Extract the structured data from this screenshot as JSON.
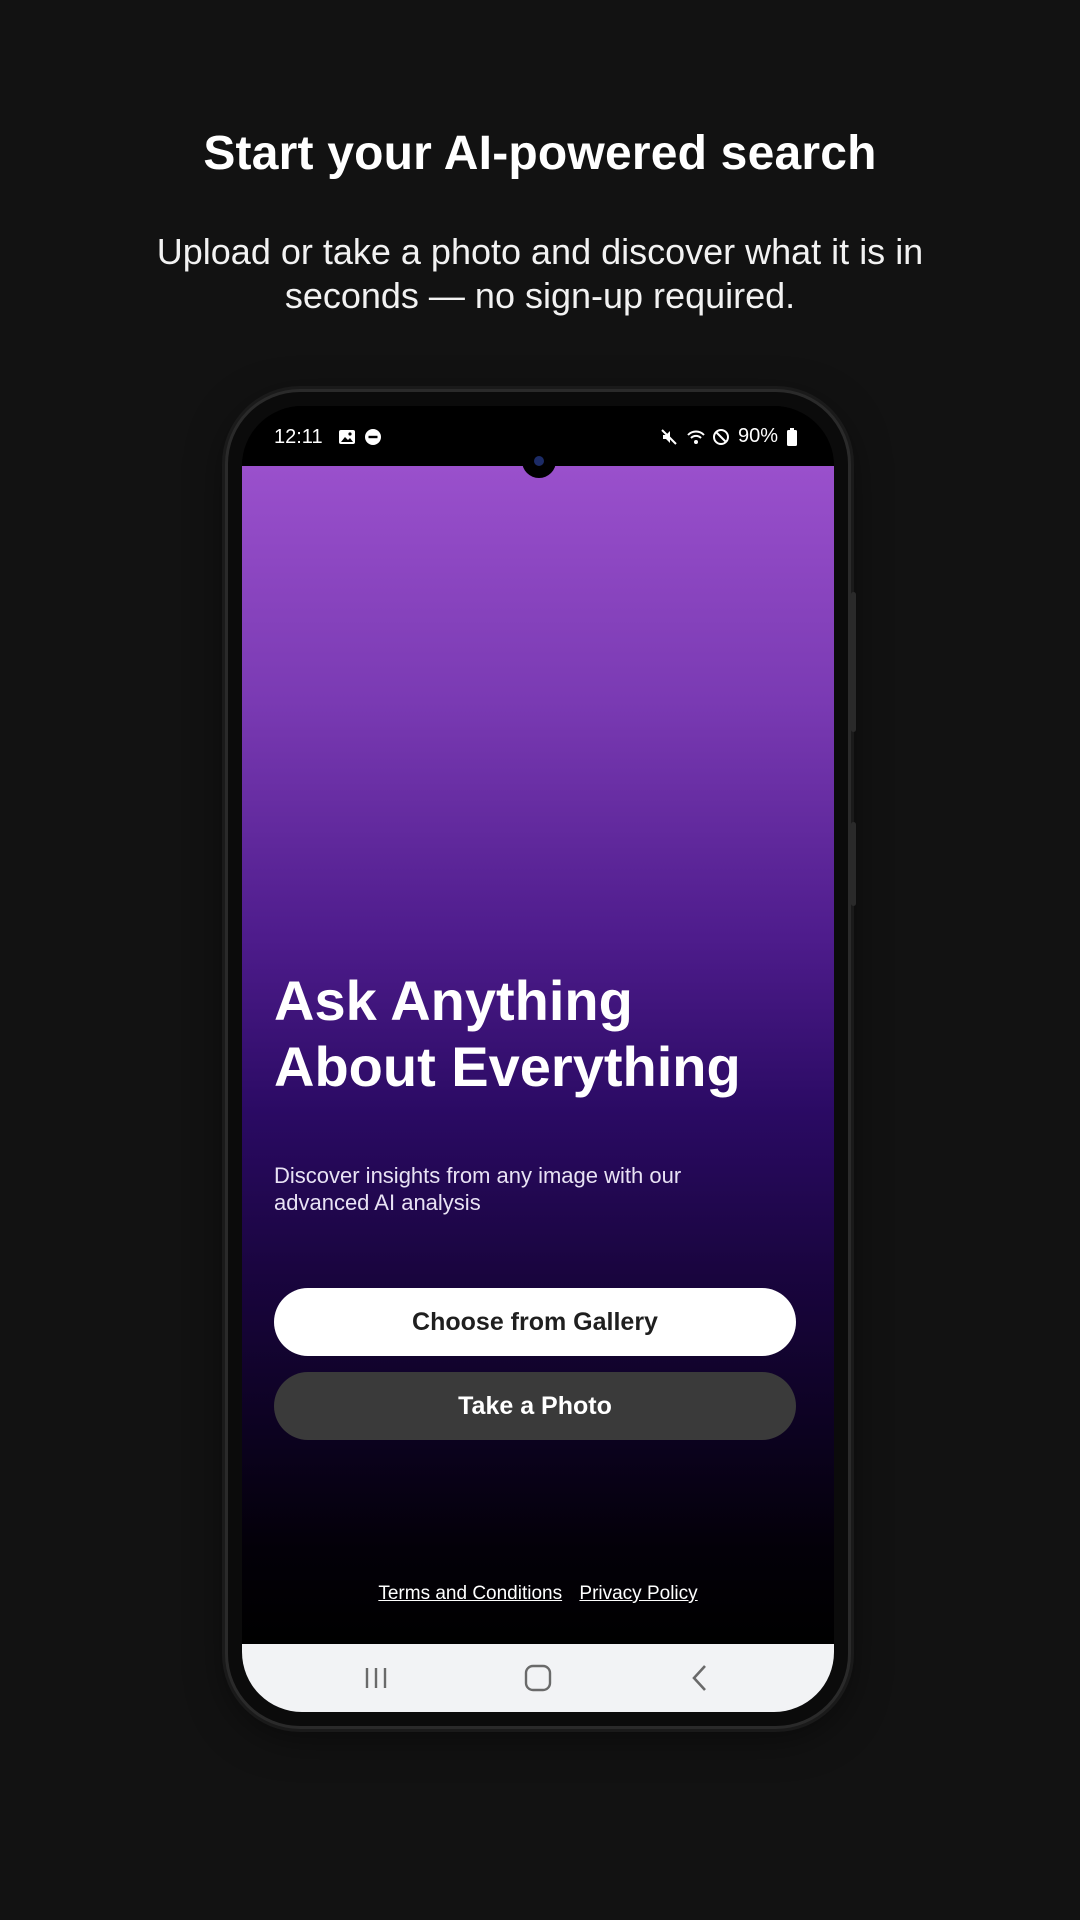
{
  "page": {
    "headline": "Start your AI-powered search",
    "subheadline": "Upload or take a photo and discover what it is in seconds — no sign-up required."
  },
  "status_bar": {
    "time": "12:11",
    "battery": "90%",
    "left_icons": [
      "image-icon",
      "dnd-icon"
    ],
    "right_icons": [
      "mute-icon",
      "wifi-icon",
      "blocked-icon",
      "battery-icon"
    ]
  },
  "app": {
    "title_line1": "Ask Anything",
    "title_line2": "About Everything",
    "description": "Discover insights from any image with our advanced AI analysis",
    "gallery_button": "Choose from Gallery",
    "photo_button": "Take a Photo",
    "terms_link": "Terms and Conditions",
    "privacy_link": "Privacy Policy"
  },
  "nav_bar": {
    "icons": [
      "recent-apps-icon",
      "home-icon",
      "back-icon"
    ]
  },
  "colors": {
    "background": "#121212",
    "gradient_top": "#9a50cc",
    "gradient_mid": "#2a0a63",
    "gradient_bottom": "#000000",
    "primary_button": "#ffffff",
    "secondary_button": "#3a3a3a",
    "nav_bar": "#f2f3f5"
  }
}
